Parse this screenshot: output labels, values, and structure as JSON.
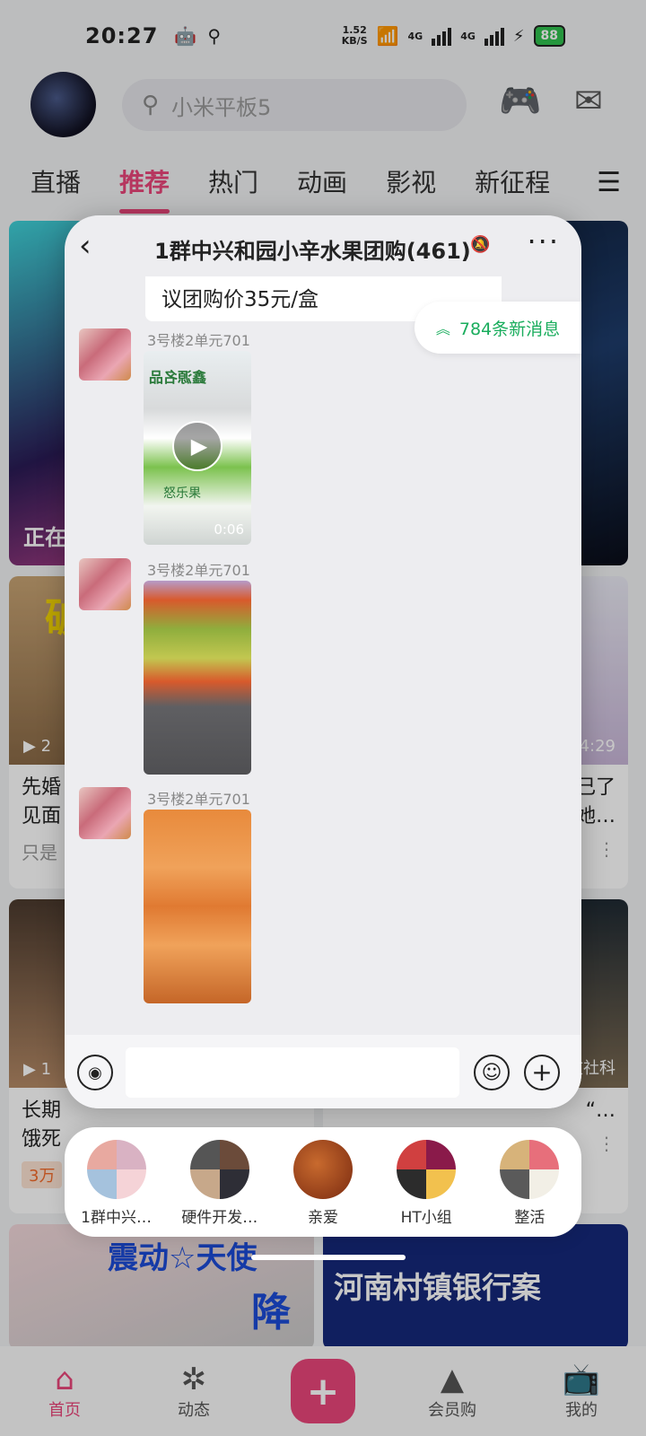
{
  "status_bar": {
    "time": "20:27",
    "net_speed_value": "1.52",
    "net_speed_unit": "KB/S",
    "sig1": "4G",
    "sig2": "4G",
    "battery": "88"
  },
  "header": {
    "search_placeholder": "小米平板5"
  },
  "tabs": [
    "直播",
    "推荐",
    "热门",
    "动画",
    "影视",
    "新征程"
  ],
  "active_tab": 1,
  "feed": {
    "card1_overlay": "正在",
    "card2_title": "先婚\n见面",
    "card2_meta": "只是",
    "card2_dur_prefix": "2",
    "card3_dur": "4:29",
    "card3_title": "己了\n她…",
    "card4_title": "长期\n饿死",
    "card4_tag": "3万",
    "card4_dur_prefix": "1",
    "card5_overlay": "文社科",
    "card5_title": "“…",
    "card6_banner": "震动☆天使",
    "card6_banner2": "降",
    "card7_banner": "河南村镇银行案",
    "card2_banner": "破"
  },
  "bottom_nav": {
    "home": "首页",
    "dynamic": "动态",
    "add": "+",
    "shop": "会员购",
    "mine": "我的"
  },
  "chat": {
    "title": "1群中兴和园小辛水果团购(461)",
    "top_message": "议团购价35元/盒",
    "new_messages": "784条新消息",
    "messages": [
      {
        "sender": "3号楼2单元701",
        "type": "video",
        "duration": "0:06"
      },
      {
        "sender": "3号楼2单元701",
        "type": "image"
      },
      {
        "sender": "3号楼2单元701",
        "type": "image"
      }
    ]
  },
  "recent_chats": [
    {
      "name": "1群中兴…"
    },
    {
      "name": "硬件开发…"
    },
    {
      "name": "亲爱"
    },
    {
      "name": "HT小组"
    },
    {
      "name": "整活"
    }
  ],
  "colors": {
    "accent": "#e9467a",
    "new_msg": "#1aad5d",
    "battery": "#30c04f"
  }
}
